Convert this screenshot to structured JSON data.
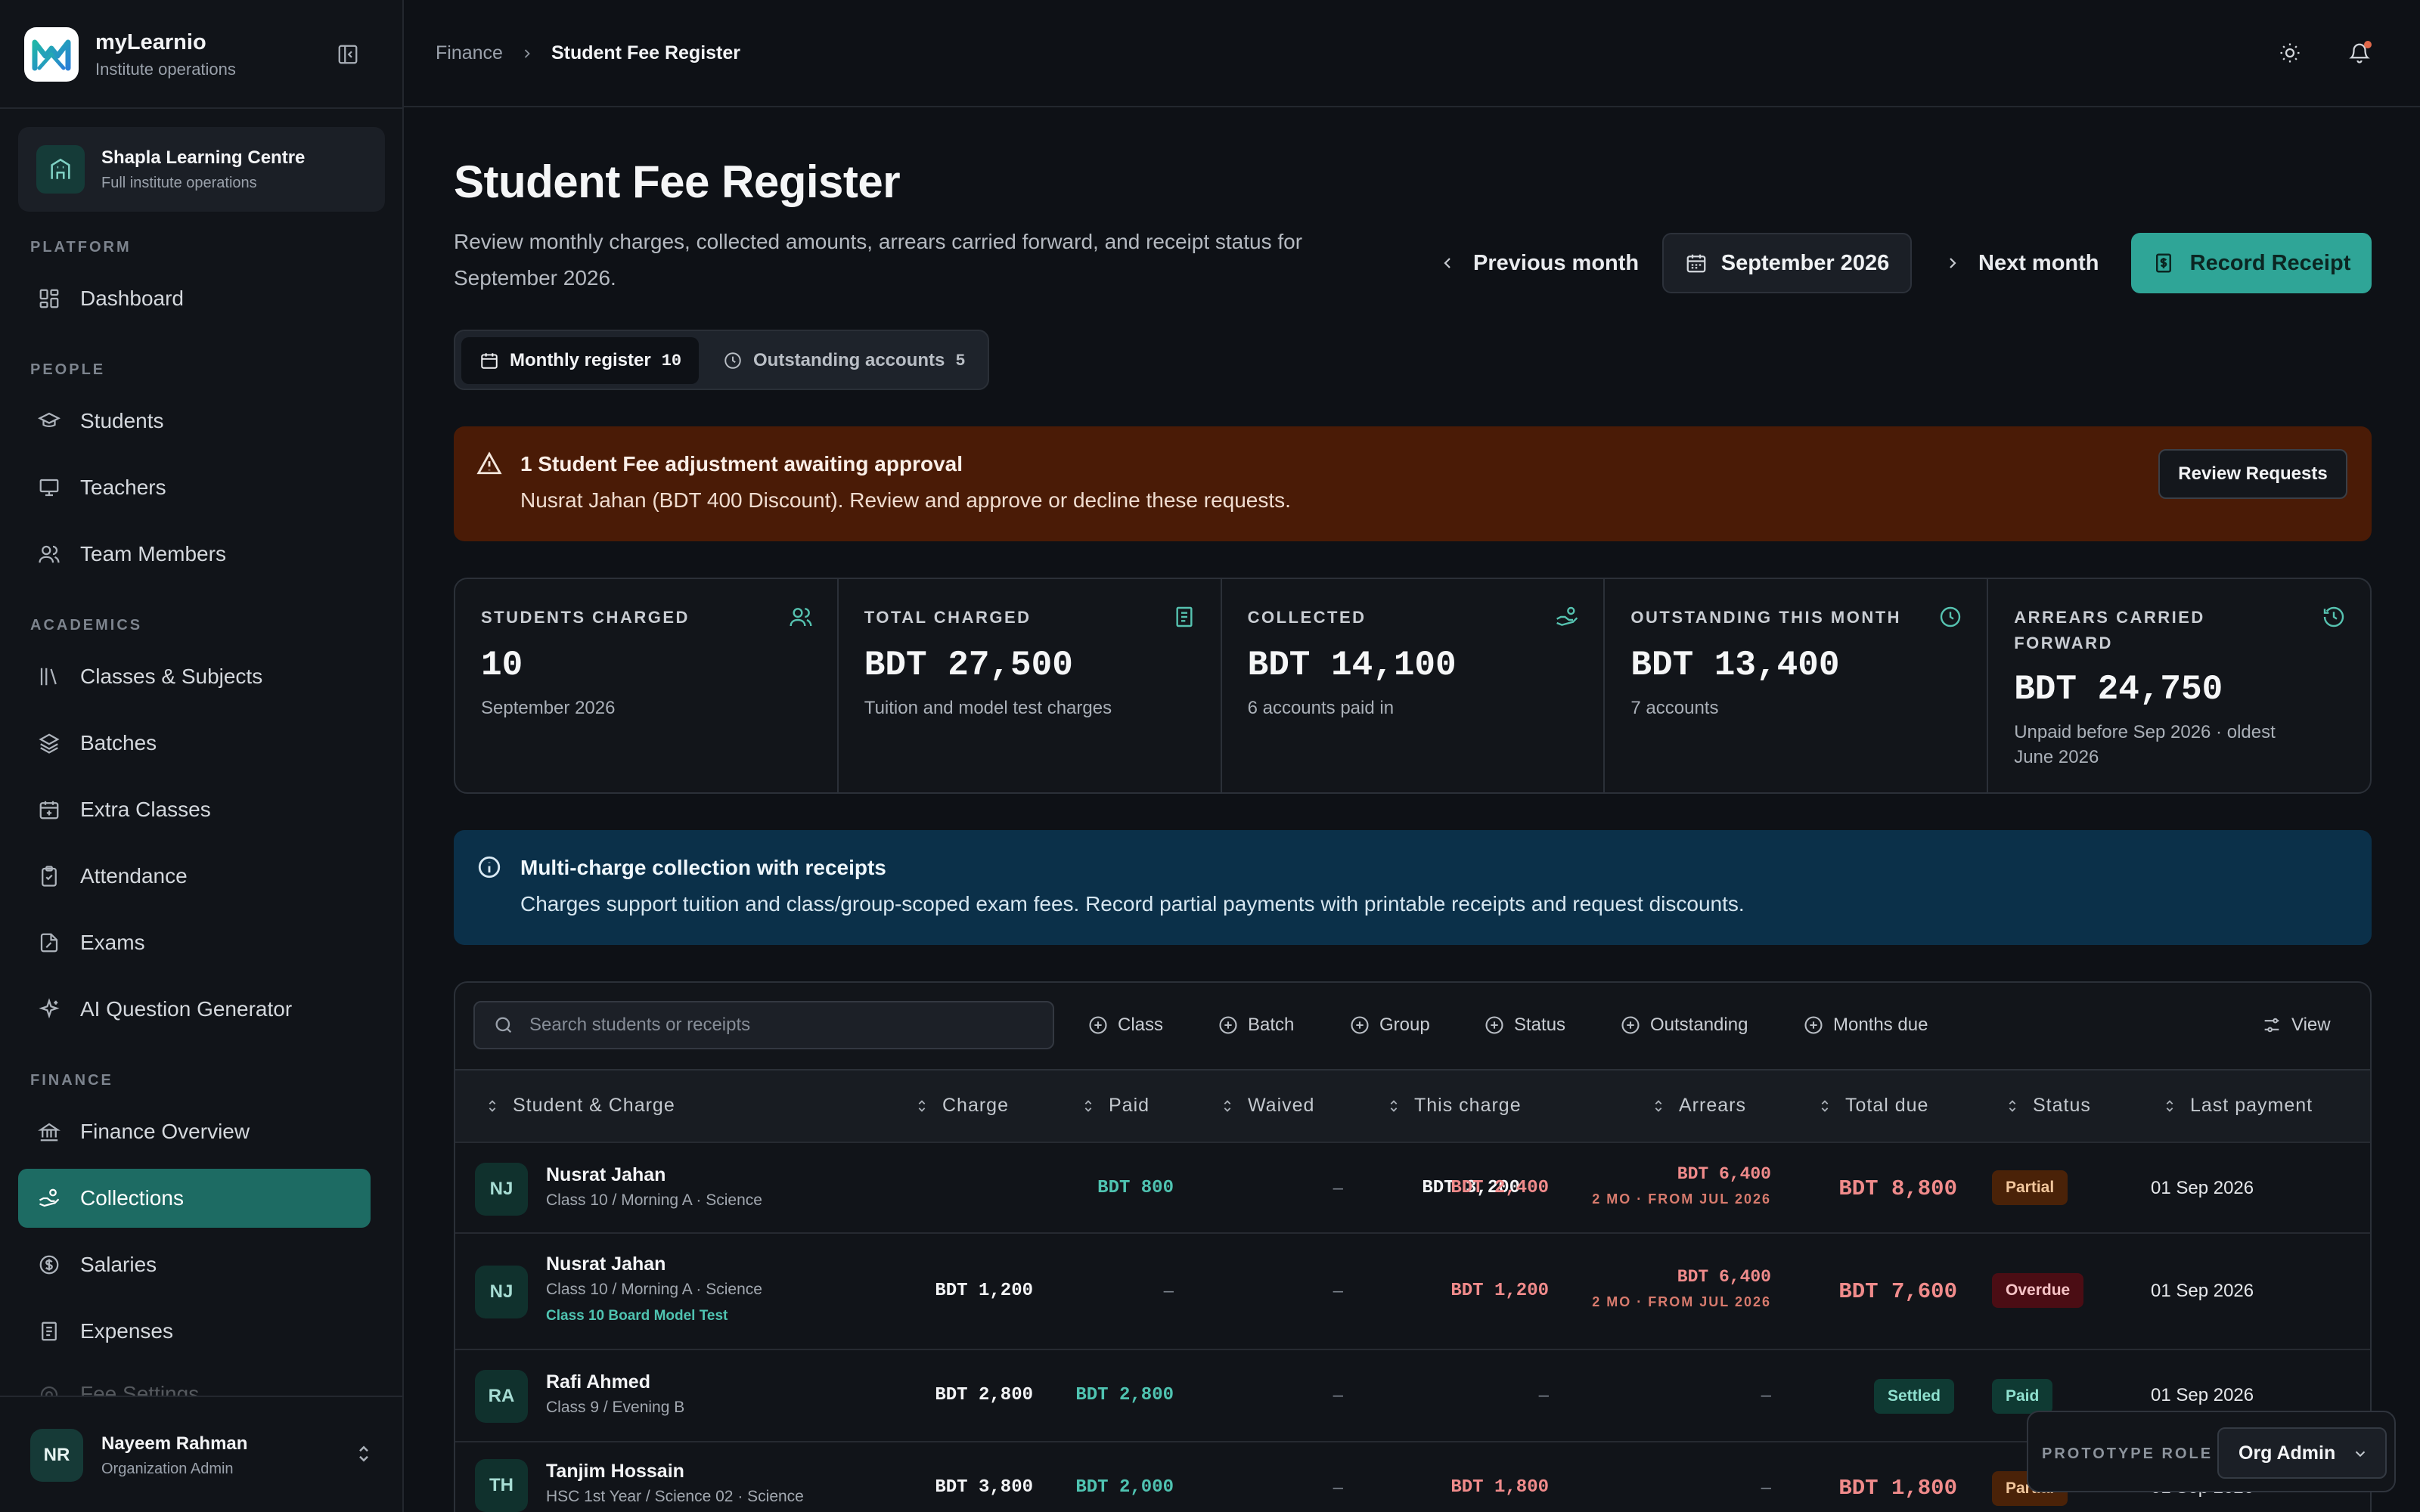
{
  "brand": {
    "name": "myLearnio",
    "subtitle": "Institute operations"
  },
  "org": {
    "name": "Shapla Learning Centre",
    "subtitle": "Full institute operations"
  },
  "nav": {
    "sections": {
      "platform": "PLATFORM",
      "people": "PEOPLE",
      "academics": "ACADEMICS",
      "finance": "FINANCE"
    },
    "items": {
      "dashboard": "Dashboard",
      "students": "Students",
      "teachers": "Teachers",
      "team_members": "Team Members",
      "classes_subjects": "Classes & Subjects",
      "batches": "Batches",
      "extra_classes": "Extra Classes",
      "attendance": "Attendance",
      "exams": "Exams",
      "ai_question_generator": "AI Question Generator",
      "finance_overview": "Finance Overview",
      "collections": "Collections",
      "salaries": "Salaries",
      "expenses": "Expenses",
      "fee_settings": "Fee Settings"
    }
  },
  "user": {
    "initials": "NR",
    "name": "Nayeem Rahman",
    "role": "Organization Admin"
  },
  "breadcrumb": {
    "parent": "Finance",
    "current": "Student Fee Register"
  },
  "page": {
    "title": "Student Fee Register",
    "description": "Review monthly charges, collected amounts, arrears carried forward, and receipt status for September 2026."
  },
  "month_nav": {
    "previous": "Previous month",
    "current": "September 2026",
    "next": "Next month",
    "record": "Record Receipt"
  },
  "tabs": {
    "monthly": {
      "label": "Monthly register",
      "count": "10"
    },
    "outstanding": {
      "label": "Outstanding accounts",
      "count": "5"
    }
  },
  "approval_alert": {
    "title": "1 Student Fee adjustment awaiting approval",
    "text": "Nusrat Jahan (BDT 400 Discount). Review and approve or decline these requests.",
    "button": "Review Requests"
  },
  "kpis": {
    "students": {
      "label": "STUDENTS CHARGED",
      "value": "10",
      "sub": "September 2026"
    },
    "charged": {
      "label": "TOTAL CHARGED",
      "value": "BDT 27,500",
      "sub": "Tuition and model test charges"
    },
    "collected": {
      "label": "COLLECTED",
      "value": "BDT 14,100",
      "sub": "6 accounts paid in"
    },
    "outstanding": {
      "label": "OUTSTANDING THIS MONTH",
      "value": "BDT 13,400",
      "sub": "7 accounts"
    },
    "arrears": {
      "label": "ARREARS CARRIED FORWARD",
      "value": "BDT 24,750",
      "sub": "Unpaid before Sep 2026 · oldest June 2026"
    }
  },
  "info_alert": {
    "title": "Multi-charge collection with receipts",
    "text": "Charges support tuition and class/group-scoped exam fees. Record partial payments with printable receipts and request discounts."
  },
  "filters": {
    "search_placeholder": "Search students or receipts",
    "class": "Class",
    "batch": "Batch",
    "group": "Group",
    "status": "Status",
    "outstanding": "Outstanding",
    "months_due": "Months due",
    "view": "View"
  },
  "columns": {
    "student": "Student & Charge",
    "charge": "Charge",
    "paid": "Paid",
    "waived": "Waived",
    "this_charge": "This charge",
    "arrears": "Arrears",
    "total_due": "Total due",
    "status": "Status",
    "last_payment": "Last payment"
  },
  "rows": [
    {
      "initials": "NJ",
      "name": "Nusrat Jahan",
      "sub": "Class 10 / Morning A · Science",
      "link": "",
      "charge": "BDT 3,200",
      "paid": "BDT 800",
      "waived": "–",
      "this_charge": "BDT 2,400",
      "arrears": "BDT 6,400",
      "arrears_sub": "2 MO · FROM JUL 2026",
      "total_due": "BDT 8,800",
      "status": "Partial",
      "last_payment": "01 Sep 2026"
    },
    {
      "initials": "NJ",
      "name": "Nusrat Jahan",
      "sub": "Class 10 / Morning A · Science",
      "link": "Class 10 Board Model Test",
      "charge": "BDT 1,200",
      "paid": "–",
      "waived": "–",
      "this_charge": "BDT 1,200",
      "arrears": "BDT 6,400",
      "arrears_sub": "2 MO · FROM JUL 2026",
      "total_due": "BDT 7,600",
      "status": "Overdue",
      "last_payment": "01 Sep 2026"
    },
    {
      "initials": "RA",
      "name": "Rafi Ahmed",
      "sub": "Class 9 / Evening B",
      "link": "",
      "charge": "BDT 2,800",
      "paid": "BDT 2,800",
      "waived": "–",
      "this_charge": "–",
      "arrears": "–",
      "arrears_sub": "",
      "total_due": "Settled",
      "status": "Paid",
      "last_payment": "01 Sep 2026"
    },
    {
      "initials": "TH",
      "name": "Tanjim Hossain",
      "sub": "HSC 1st Year / Science 02 · Science",
      "link": "",
      "charge": "BDT 3,800",
      "paid": "BDT 2,000",
      "waived": "–",
      "this_charge": "BDT 1,800",
      "arrears": "–",
      "arrears_sub": "",
      "total_due": "BDT 1,800",
      "status": "Partial",
      "last_payment": "01 Sep 2026"
    }
  ],
  "prototype": {
    "label": "PROTOTYPE ROLE",
    "value": "Org Admin"
  },
  "colors": {
    "accent": "#2fa597",
    "active_nav": "#1d6b63",
    "warning_bg": "#4a1b06",
    "info_bg": "#0b3049"
  }
}
